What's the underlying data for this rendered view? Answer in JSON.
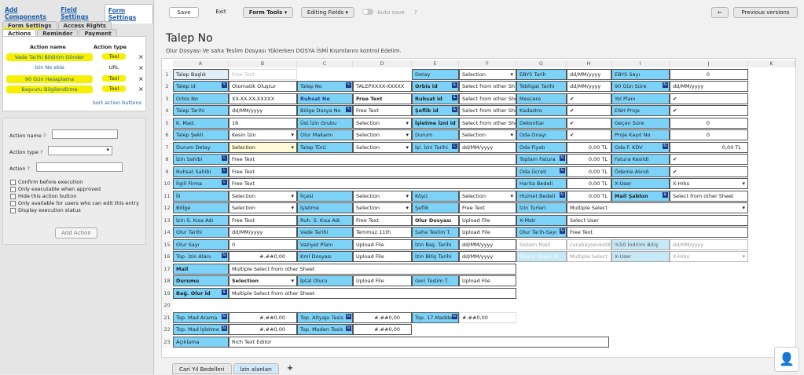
{
  "left": {
    "tabs": [
      "Add Components",
      "Field Settings",
      "Form Settings"
    ],
    "subtabs_row1": [
      "Form Settings",
      "Access Rights"
    ],
    "subtabs_row2": [
      "Actions",
      "Reminder",
      "Payment"
    ],
    "headers": {
      "name": "Action name",
      "type": "Action type"
    },
    "actions": [
      {
        "name": "Vade Tarihi Bildirim Gönder",
        "type": "Tool"
      },
      {
        "name": "İzin No ekle",
        "type": "URL"
      },
      {
        "name": "90 Gün Hesaplama",
        "type": "Tool"
      },
      {
        "name": "Başvuru Bilgilendirme",
        "type": "Tool"
      }
    ],
    "sort_link": "Sort action buttons",
    "form": {
      "name_label": "Action name",
      "type_label": "Action type",
      "action_label": "Action",
      "q": "?"
    },
    "checks": [
      "Confirm before execution",
      "Only executable when approved",
      "Hide this action button",
      "Only available for users who can edit this entry",
      "Display execution status"
    ],
    "add_button": "Add Action"
  },
  "toolbar": {
    "save": "Save",
    "exit": "Exit",
    "form_tools": "Form Tools",
    "editing_fields": "Editing Fields",
    "auto_save": "Auto save",
    "previous": "Previous versions",
    "back_icon": "arrow-left-icon"
  },
  "title": "Talep No",
  "subtitle": "Olur Dosyası Ve saha Teslim Dosyası Yüklerken DOSYA İSMİ Kısımlarını kontrol Edelim.",
  "columns": [
    "A",
    "B",
    "C",
    "D",
    "E",
    "F",
    "G",
    "H",
    "I",
    "J",
    "K"
  ],
  "rows": [
    "1",
    "2",
    "3",
    "4",
    "5",
    "6",
    "7",
    "8",
    "9",
    "10",
    "11",
    "12",
    "13",
    "14",
    "15",
    "16",
    "17",
    "18",
    "19",
    "20",
    "21",
    "22",
    "23"
  ],
  "cells": {
    "r1": [
      "Talep Başlık",
      "Free Text",
      "Detay",
      "Selection",
      "EBYS Tarih",
      "dd/MM/yyyy",
      "EBYS Sayı",
      "0"
    ],
    "r2": [
      "Talep id",
      "Otomatik Oluştur",
      "Talep No",
      "TALEPXXXX-XXXXX",
      "Orbis id",
      "Select from other Sh",
      "Tebligat Tarihi",
      "dd/MM/yyyy",
      "90 Gün Süre",
      "dd/MM/yyyy"
    ],
    "r3": [
      "Orbis No",
      "XX-XX-XX-XXXXX",
      "Ruhsat No",
      "Free Text",
      "Ruhsat id",
      "Select from other She",
      "Mescere",
      "✔",
      "Yol Planı",
      "✔"
    ],
    "r4": [
      "Talep Tarihi",
      "dd/MM/yyyy",
      "Bölge Dosya No",
      "Free Text",
      "Şeflik id",
      "Select from other She",
      "Kadastro",
      "✔",
      "ENH Proje",
      "✔"
    ],
    "r5": [
      "K. Mad.",
      "16",
      "Üst İzin Grubu",
      "Selection",
      "İşletme İzni id",
      "Select from other She",
      "Dekontlar",
      "✔",
      "Geçen Süre",
      "0"
    ],
    "r6": [
      "Talep Şekli",
      "Kesin İzin",
      "Olur Makamı",
      "Selection",
      "Durum",
      "Selection",
      "Oda Onayı",
      "✔",
      "Proje Kayıt No",
      "0"
    ],
    "r7": [
      "Durum Detay",
      "Selection",
      "Talep Türü",
      "Selection",
      "İşl. İzni Tarihi",
      "dd/MM/yyyy",
      "Oda Fiyatı",
      "0,00 TL",
      "Oda F. KDV",
      "0,00 TL"
    ],
    "r8": [
      "İzin Sahibi",
      "Free Text",
      "Toplam Fatura",
      "0,00 TL",
      "Fatura Kesildi",
      "✔"
    ],
    "r9": [
      "Ruhsat Sahibi",
      "Free Text",
      "Oda Ücreti",
      "0,00 TL",
      "Ödeme Alındı",
      "✔"
    ],
    "r10": [
      "İlgili Firma",
      "Free Text",
      "Harita Bedeli",
      "0,00 TL",
      "X-User",
      "X-Hrks"
    ],
    "r11": [
      "İli",
      "Selection",
      "İlçesi",
      "Selection",
      "Köyü",
      "Selection",
      "Hizmet Bedeli",
      "0,00 TL",
      "Mail Şablon",
      "Select from other Sheet"
    ],
    "r12": [
      "Bölge",
      "Selection",
      "İşletme",
      "Selection",
      "Şeflik",
      "Free Text",
      "İzin Turleri",
      "Multiple Select"
    ],
    "r13": [
      "İzin S. Kısa Adı",
      "Free Text",
      "Ruh. S. Kısa Adı",
      "Free Text",
      "Olur Dosyası",
      "Upload File",
      "X-Mstr",
      "Select User"
    ],
    "r14": [
      "Olur Tarihi",
      "dd/MM/yyyy",
      "Vade Tarihi",
      "Temmuz 11th",
      "Saha Teslim T.",
      "Upload File",
      "Olur Tarih-Sayı",
      "Free Text"
    ],
    "r15": [
      "Olur Sayı",
      "0",
      "Vaziyet Planı",
      "Upload File",
      "İzin Baş. Tarihi",
      "dd/MM/yyyy",
      "Sistem Maili",
      "curabaysevket8",
      "%50 İndirim Bitiş",
      "dd/MM/yyyy"
    ],
    "r16": [
      "Top. İzin Alanı",
      "#.##0,00",
      "Kml Dosyası",
      "Upload File",
      "İzin Bitiş Tarihi",
      "dd/MM/yyyy",
      "Teknik Rapor N",
      "Multiple Select",
      "X-User",
      "X-Hrks"
    ],
    "r17": [
      "Mail",
      "Multiple Select from other Sheet"
    ],
    "r18": [
      "Durumu",
      "Selection",
      "İptal Oluru",
      "Upload File",
      "Geri Teslim T.",
      "Upload File"
    ],
    "r19": [
      "Bağ. Olur İd",
      "Multiple Select from other Sheet"
    ],
    "r21": [
      "Top. Mad Arama",
      "#.##0,00",
      "Top. Altyapı Tesis",
      "#.##0,00",
      "Top. 17.Madde",
      "#.##0,00"
    ],
    "r22": [
      "Top. Mad İşletme",
      "#.##0,00",
      "Top. Maden Tesis",
      "#.##0,00"
    ],
    "r23": [
      "Açıklama",
      "Rich Text Editor"
    ]
  },
  "sheet_tabs": [
    "Cari Yıl Bedelleri",
    "İzin alanları",
    "+"
  ],
  "tag_fx": "fx",
  "tag_l": "L",
  "tag_pencil": "✎",
  "colors": {
    "field_blue": "#7dd2f7",
    "highlight": "#f6f000",
    "link": "#1a5ea8"
  }
}
